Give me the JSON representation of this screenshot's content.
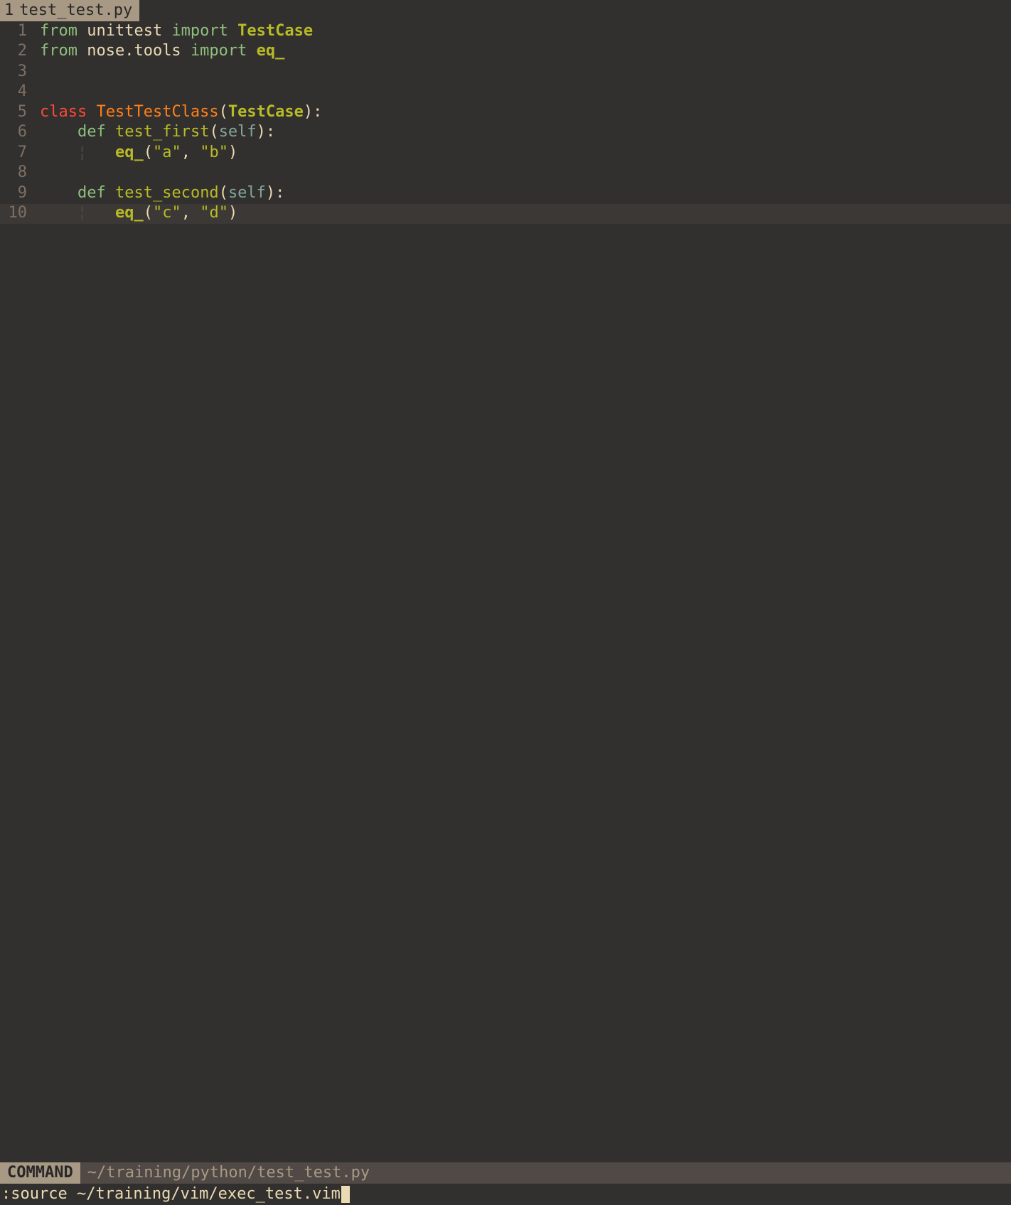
{
  "tab": {
    "index": "1",
    "filename": "test_test.py"
  },
  "lines": [
    {
      "num": "1",
      "current": false,
      "segments": [
        {
          "cls": "k-aqua",
          "t": "from"
        },
        {
          "cls": "k-fg",
          "t": " unittest "
        },
        {
          "cls": "k-aqua",
          "t": "import"
        },
        {
          "cls": "k-fg",
          "t": " "
        },
        {
          "cls": "k-greenb",
          "t": "TestCase"
        }
      ]
    },
    {
      "num": "2",
      "current": false,
      "segments": [
        {
          "cls": "k-aqua",
          "t": "from"
        },
        {
          "cls": "k-fg",
          "t": " nose.tools "
        },
        {
          "cls": "k-aqua",
          "t": "import"
        },
        {
          "cls": "k-fg",
          "t": " "
        },
        {
          "cls": "k-greenb",
          "t": "eq_"
        }
      ]
    },
    {
      "num": "3",
      "current": false,
      "segments": []
    },
    {
      "num": "4",
      "current": false,
      "segments": []
    },
    {
      "num": "5",
      "current": false,
      "segments": [
        {
          "cls": "k-red",
          "t": "class"
        },
        {
          "cls": "k-fg",
          "t": " "
        },
        {
          "cls": "k-orange",
          "t": "TestTestClass"
        },
        {
          "cls": "k-fg",
          "t": "("
        },
        {
          "cls": "k-greenb",
          "t": "TestCase"
        },
        {
          "cls": "k-fg",
          "t": "):"
        }
      ]
    },
    {
      "num": "6",
      "current": false,
      "segments": [
        {
          "cls": "k-fg",
          "t": "    "
        },
        {
          "cls": "k-aqua",
          "t": "def"
        },
        {
          "cls": "k-fg",
          "t": " "
        },
        {
          "cls": "k-green",
          "t": "test_first"
        },
        {
          "cls": "k-fg",
          "t": "("
        },
        {
          "cls": "k-blue",
          "t": "self"
        },
        {
          "cls": "k-fg",
          "t": "):"
        }
      ]
    },
    {
      "num": "7",
      "current": false,
      "segments": [
        {
          "cls": "k-fg",
          "t": "    "
        },
        {
          "cls": "k-guide",
          "t": "¦"
        },
        {
          "cls": "k-fg",
          "t": "   "
        },
        {
          "cls": "k-greenb",
          "t": "eq_"
        },
        {
          "cls": "k-fg",
          "t": "("
        },
        {
          "cls": "k-green",
          "t": "\"a\""
        },
        {
          "cls": "k-fg",
          "t": ", "
        },
        {
          "cls": "k-green",
          "t": "\"b\""
        },
        {
          "cls": "k-fg",
          "t": ")"
        }
      ]
    },
    {
      "num": "8",
      "current": false,
      "segments": []
    },
    {
      "num": "9",
      "current": false,
      "segments": [
        {
          "cls": "k-fg",
          "t": "    "
        },
        {
          "cls": "k-aqua",
          "t": "def"
        },
        {
          "cls": "k-fg",
          "t": " "
        },
        {
          "cls": "k-green",
          "t": "test_second"
        },
        {
          "cls": "k-fg",
          "t": "("
        },
        {
          "cls": "k-blue",
          "t": "self"
        },
        {
          "cls": "k-fg",
          "t": "):"
        }
      ]
    },
    {
      "num": "10",
      "current": true,
      "segments": [
        {
          "cls": "k-fg",
          "t": "    "
        },
        {
          "cls": "k-guide",
          "t": "¦"
        },
        {
          "cls": "k-fg",
          "t": "   "
        },
        {
          "cls": "k-greenb",
          "t": "eq_"
        },
        {
          "cls": "k-fg",
          "t": "("
        },
        {
          "cls": "k-green",
          "t": "\"c\""
        },
        {
          "cls": "k-fg",
          "t": ", "
        },
        {
          "cls": "k-green",
          "t": "\"d\""
        },
        {
          "cls": "k-fg",
          "t": ")"
        }
      ]
    }
  ],
  "status": {
    "mode": "COMMAND",
    "filepath": "~/training/python/test_test.py"
  },
  "command": {
    "prefix": ":",
    "text": "source ~/training/vim/exec_test.vim"
  }
}
